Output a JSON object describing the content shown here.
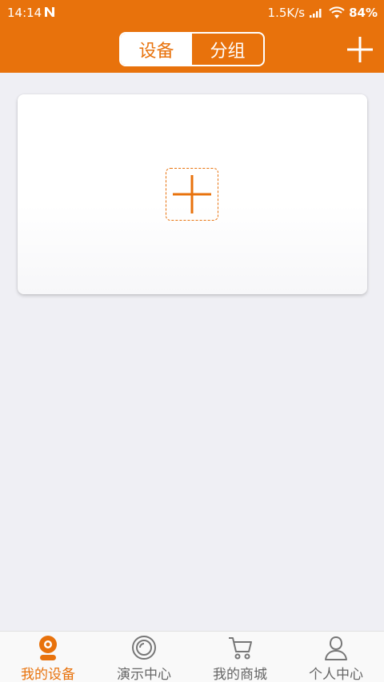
{
  "status_bar": {
    "time": "14:14",
    "network_speed": "1.5K/s",
    "battery": "84%",
    "icons": [
      "n-icon",
      "signal-icon",
      "wifi-icon"
    ]
  },
  "header": {
    "segments": [
      {
        "label": "设备",
        "active": true
      },
      {
        "label": "分组",
        "active": false
      }
    ],
    "add_icon": "plus-icon"
  },
  "card": {
    "add_device_icon": "plus-icon"
  },
  "tabbar": {
    "items": [
      {
        "label": "我的设备",
        "icon": "camera-icon",
        "active": true
      },
      {
        "label": "演示中心",
        "icon": "lens-icon",
        "active": false
      },
      {
        "label": "我的商城",
        "icon": "cart-icon",
        "active": false
      },
      {
        "label": "个人中心",
        "icon": "person-icon",
        "active": false
      }
    ]
  },
  "colors": {
    "accent": "#e8720c",
    "background": "#efeff4",
    "inactive_text": "#666666"
  }
}
